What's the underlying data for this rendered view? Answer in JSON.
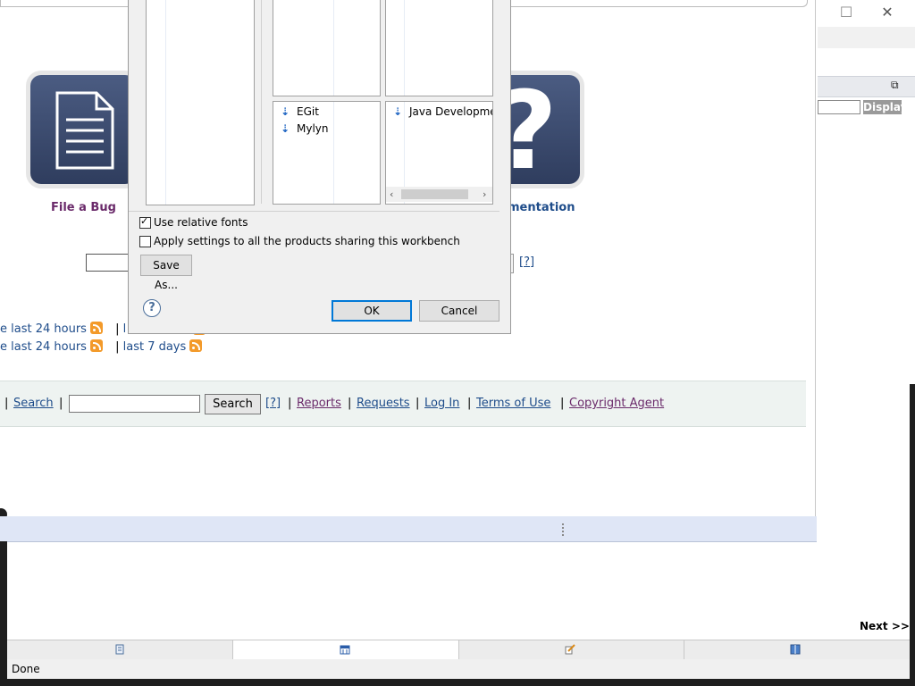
{
  "window": {
    "maximize_glyph": "☐",
    "close_glyph": "✕",
    "restore_glyph": "⧉"
  },
  "sidebar": {
    "display_label": "Display"
  },
  "page": {
    "tiles": [
      {
        "label": "File a Bug"
      },
      {
        "label": "mentation"
      }
    ],
    "help_link": "[?]",
    "feeds": [
      {
        "text1": "e last 24 hours",
        "sep": "|",
        "text2": "l"
      },
      {
        "text1": "e last 24 hours",
        "sep": "|",
        "text2": "last 7 days"
      }
    ],
    "footer": {
      "sep": "|",
      "search_link": "Search",
      "search_button": "Search",
      "help": "[?]",
      "reports": "Reports",
      "requests": "Requests",
      "login": "Log In",
      "terms": "Terms of Use",
      "copyright": "Copyright Agent"
    }
  },
  "dialog": {
    "list_a": [
      "EGit",
      "Mylyn"
    ],
    "list_b": [
      "Java Developmen"
    ],
    "use_relative_fonts": {
      "label": "Use relative fonts",
      "checked": true
    },
    "apply_all": {
      "label": "Apply settings to all the products sharing this workbench",
      "checked": false
    },
    "save_as": "Save As...",
    "help_glyph": "?",
    "ok": "OK",
    "cancel": "Cancel"
  },
  "browser": {
    "next": "Next >>",
    "status": "Done",
    "tabs": [
      {
        "icon": "document-icon"
      },
      {
        "icon": "calendar-icon"
      },
      {
        "icon": "edit-icon"
      },
      {
        "icon": "book-icon"
      }
    ]
  },
  "colors": {
    "link": "#1e4c8a",
    "visited": "#6a2a6a",
    "tile": "#3b4a6e",
    "rss": "#f39a2a",
    "default_button_border": "#0078d7"
  }
}
